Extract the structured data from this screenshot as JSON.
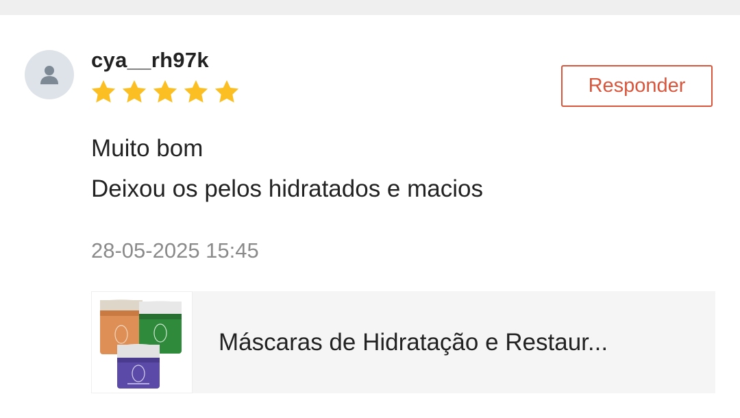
{
  "review": {
    "username": "cya__rh97k",
    "rating": 5,
    "rating_max": 5,
    "reply_label": "Responder",
    "comment_lines": [
      "Muito bom",
      "Deixou os pelos hidratados e macios"
    ],
    "timestamp": "28-05-2025 15:45"
  },
  "product": {
    "title": "Máscaras de Hidratação e Restaur...",
    "thumbnail": "product-jars-image"
  },
  "colors": {
    "accent": "#d9553b",
    "star": "#fbbf24",
    "text": "#222222",
    "muted": "#8a8a8a",
    "card_bg": "#f5f5f5"
  },
  "icons": {
    "avatar": "user-icon",
    "rating": "star-icon"
  }
}
